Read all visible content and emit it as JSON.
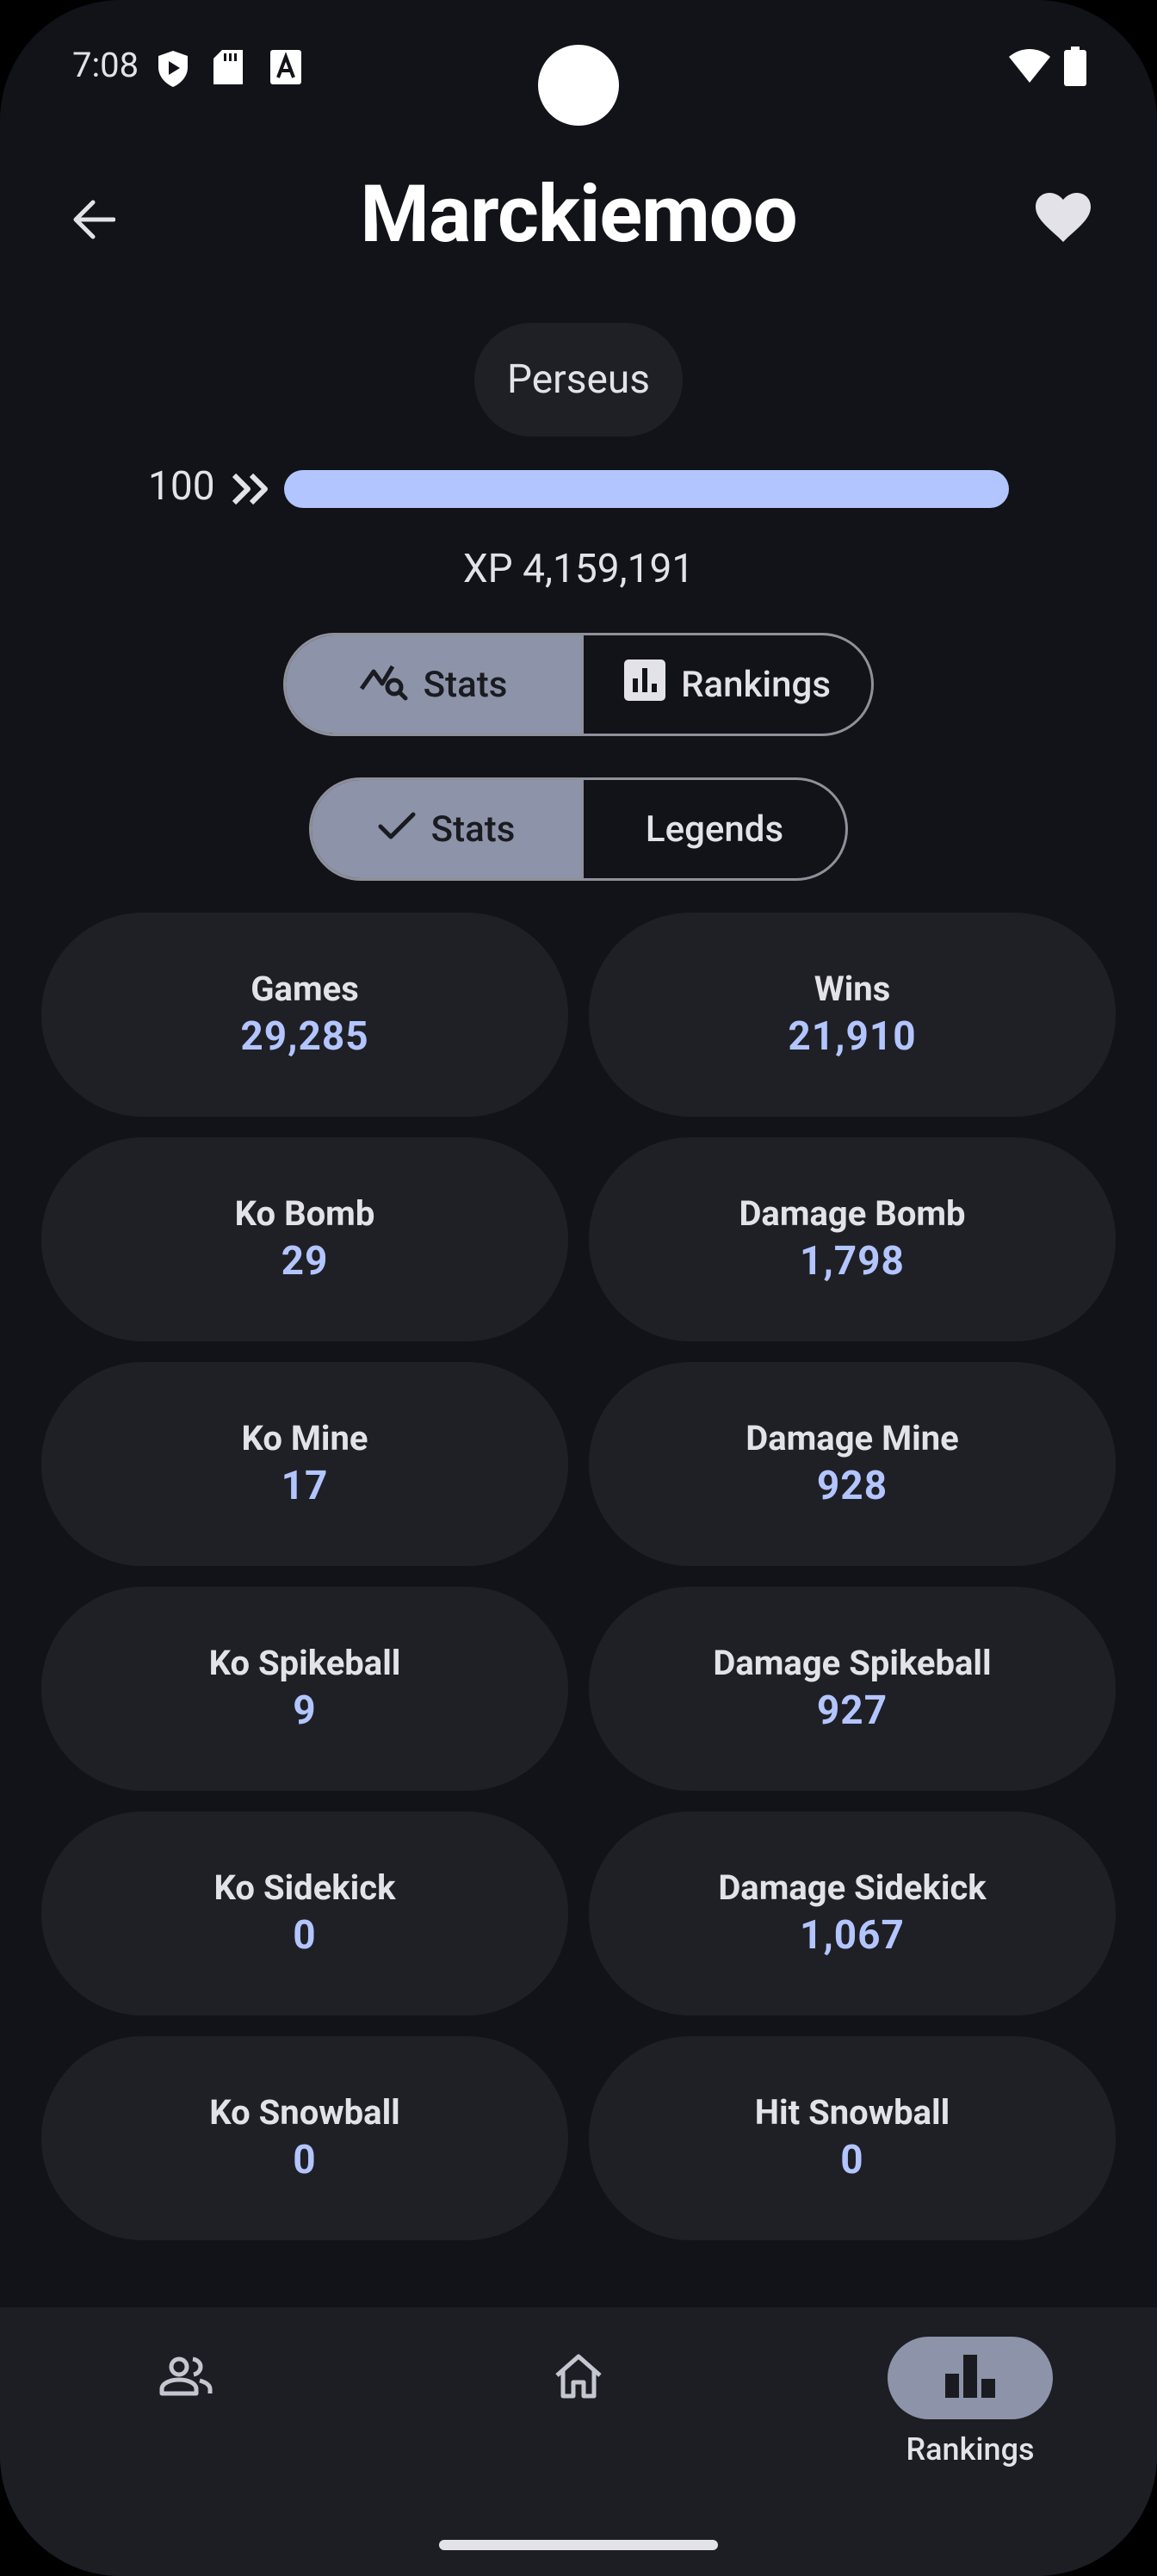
{
  "status_bar": {
    "time": "7:08",
    "left_icons": [
      "shield-play-icon",
      "sd-card-icon",
      "font-a-icon"
    ],
    "right_icons": [
      "wifi-icon",
      "battery-icon"
    ]
  },
  "app_bar": {
    "title": "Marckiemoo",
    "back_icon": "arrow-back-icon",
    "favorite_icon": "heart-icon"
  },
  "player": {
    "clan": "Perseus",
    "level": "100",
    "level_progress": 1.0,
    "xp_text": "XP 4,159,191"
  },
  "view_toggle": {
    "items": [
      {
        "label": "Stats",
        "icon": "query-stats-icon",
        "selected": true
      },
      {
        "label": "Rankings",
        "icon": "leaderboard-icon",
        "selected": false
      }
    ]
  },
  "sub_toggle": {
    "items": [
      {
        "label": "Stats",
        "icon": "check-icon",
        "selected": true
      },
      {
        "label": "Legends",
        "selected": false
      }
    ]
  },
  "stats": [
    {
      "label": "Games",
      "value": "29,285"
    },
    {
      "label": "Wins",
      "value": "21,910"
    },
    {
      "label": "Ko Bomb",
      "value": "29"
    },
    {
      "label": "Damage Bomb",
      "value": "1,798"
    },
    {
      "label": "Ko Mine",
      "value": "17"
    },
    {
      "label": "Damage Mine",
      "value": "928"
    },
    {
      "label": "Ko Spikeball",
      "value": "9"
    },
    {
      "label": "Damage Spikeball",
      "value": "927"
    },
    {
      "label": "Ko Sidekick",
      "value": "0"
    },
    {
      "label": "Damage Sidekick",
      "value": "1,067"
    },
    {
      "label": "Ko Snowball",
      "value": "0"
    },
    {
      "label": "Hit Snowball",
      "value": "0"
    }
  ],
  "bottom_nav": {
    "items": [
      {
        "icon": "people-icon",
        "label": ""
      },
      {
        "icon": "home-icon",
        "label": ""
      },
      {
        "icon": "leaderboard-icon",
        "label": "Rankings",
        "active": true
      }
    ]
  },
  "colors": {
    "background": "#121318",
    "card": "#1f2025",
    "accent": "#b3c5ff",
    "selected_segment": "#8d93a8",
    "nav_bar": "#1d1e24"
  }
}
